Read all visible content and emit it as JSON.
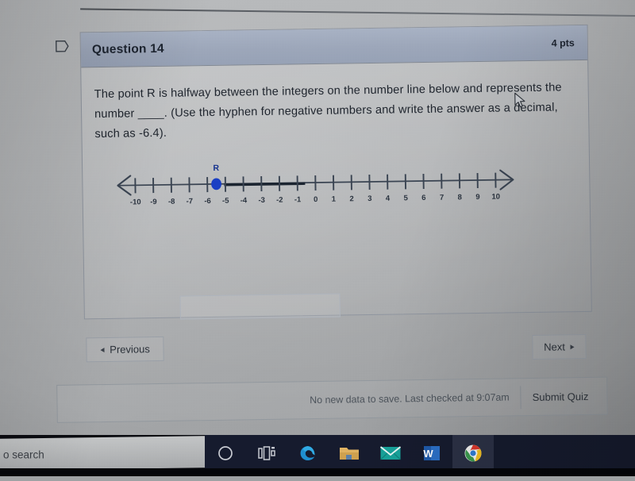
{
  "question": {
    "title": "Question 14",
    "points": "4 pts",
    "text_line1": "The point R is halfway between the integers on the number line below and represents",
    "text_line2": "the number ____. (Use the hyphen for negative numbers and write the answer as a",
    "text_line3": "decimal, such as -6.4).",
    "full_text": "The point R is halfway between the integers on the number line below and represents the number ____. (Use the hyphen for negative numbers and write the answer as a decimal, such as -6.4).",
    "flag_icon": "flag-outline-icon",
    "answer_value": "",
    "answer_placeholder": ""
  },
  "number_line": {
    "point_label": "R",
    "point_value": -5.5,
    "point_color": "#1a3fc4",
    "min": -10,
    "max": 10,
    "tick_labels": [
      "-10",
      "-9",
      "-8",
      "-7",
      "-6",
      "-5",
      "-4",
      "-3",
      "-2",
      "-1",
      "0",
      "1",
      "2",
      "3",
      "4",
      "5",
      "6",
      "7",
      "8",
      "9",
      "10"
    ],
    "left_arrow": "left-arrow-icon",
    "right_arrow": "right-arrow-icon",
    "highlight_from": -5.5,
    "highlight_to": -1.5
  },
  "navigation": {
    "previous_label": "Previous",
    "next_label": "Next",
    "previous_icon": "chevron-left-icon",
    "next_icon": "chevron-right-icon"
  },
  "save_bar": {
    "status": "No new data to save. Last checked at 9:07am",
    "submit_label": "Submit Quiz"
  },
  "taskbar": {
    "search_text": "o search",
    "items": [
      {
        "name": "cortana-icon",
        "label": "Cortana"
      },
      {
        "name": "task-view-icon",
        "label": "Task View"
      },
      {
        "name": "edge-icon",
        "label": "Microsoft Edge"
      },
      {
        "name": "file-explorer-icon",
        "label": "File Explorer"
      },
      {
        "name": "mail-icon",
        "label": "Mail"
      },
      {
        "name": "word-icon",
        "label": "Word"
      },
      {
        "name": "chrome-icon",
        "label": "Google Chrome"
      }
    ]
  },
  "cursor": {
    "name": "mouse-pointer"
  }
}
